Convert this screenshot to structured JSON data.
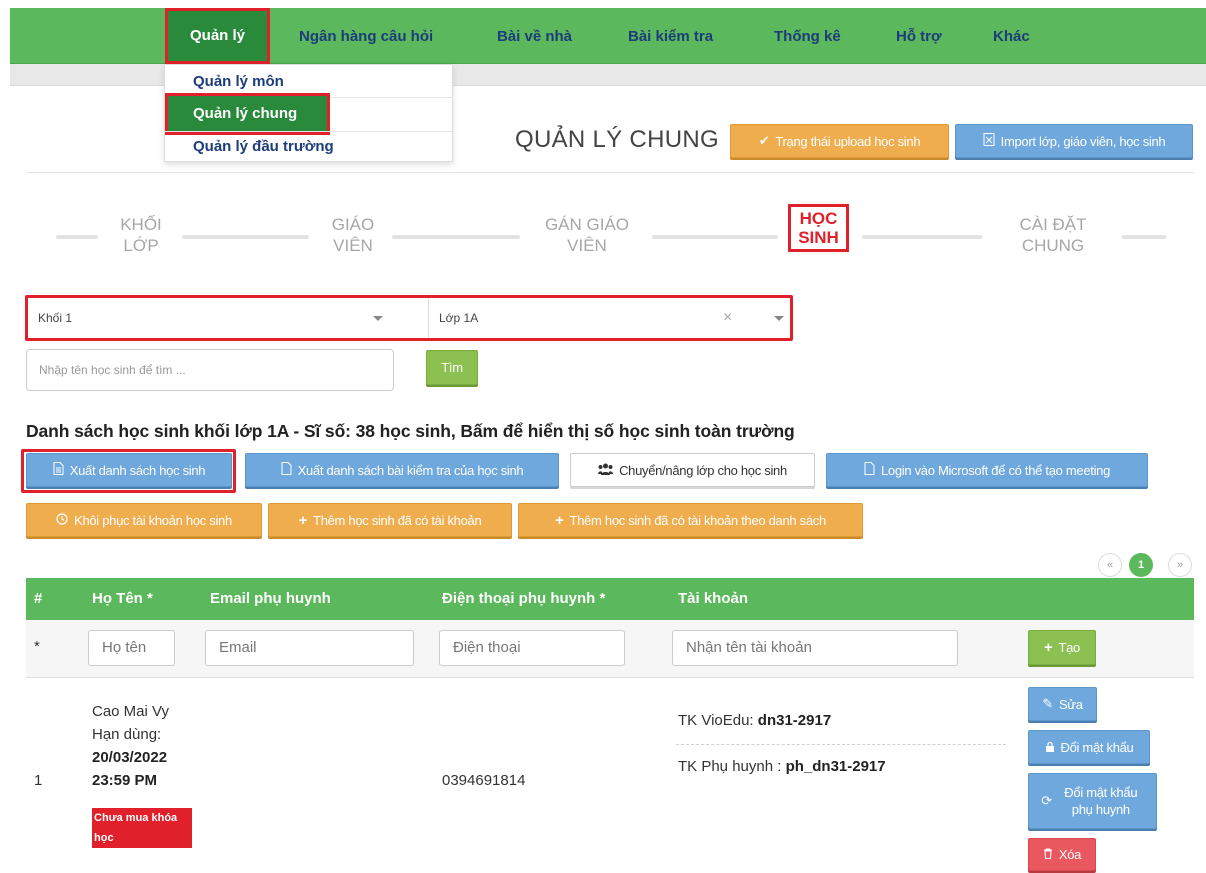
{
  "nav": {
    "items": [
      {
        "label": "Quản lý",
        "active": true
      },
      {
        "label": "Ngân hàng câu hỏi"
      },
      {
        "label": "Bài về nhà"
      },
      {
        "label": "Bài kiểm tra"
      },
      {
        "label": "Thống kê"
      },
      {
        "label": "Hỗ trợ"
      },
      {
        "label": "Khác"
      }
    ],
    "dropdown": [
      {
        "label": "Quản lý môn"
      },
      {
        "label": "Quản lý chung",
        "active": true
      },
      {
        "label": "Quản lý đầu trường"
      }
    ]
  },
  "header": {
    "title": "QUẢN LÝ CHUNG",
    "upload_status_label": "Trạng thái upload học sinh",
    "import_label": "Import lớp, giáo viên, học sinh"
  },
  "steps": [
    {
      "line1": "KHỐI",
      "line2": "LỚP"
    },
    {
      "line1": "GIÁO",
      "line2": "VIÊN"
    },
    {
      "line1": "GÁN GIÁO",
      "line2": "VIÊN"
    },
    {
      "line1": "HỌC",
      "line2": "SINH",
      "active": true
    },
    {
      "line1": "CÀI ĐẶT",
      "line2": "CHUNG"
    }
  ],
  "filters": {
    "grade_value": "Khối 1",
    "class_value": "Lớp 1A",
    "clear_symbol": "×",
    "search_placeholder": "Nhập tên học sinh để tìm ...",
    "search_button": "Tìm"
  },
  "list_title": "Danh sách học sinh khối lớp 1A - Sĩ số: 38 học sinh, Bấm để hiển thị số học sinh toàn trường",
  "actions": {
    "export_students": "Xuất danh sách học sinh",
    "export_tests": "Xuất danh sách bài kiểm tra của học sinh",
    "move_class": "Chuyển/nâng lớp cho học sinh",
    "login_microsoft": "Login vào Microsoft để có thể tạo meeting",
    "restore_accounts": "Khôi phục tài khoản học sinh",
    "add_existing": "Thêm học sinh đã có tài khoản",
    "add_existing_list": "Thêm học sinh đã có tài khoản theo danh sách"
  },
  "pagination": {
    "prev": "«",
    "current": "1",
    "next": "»"
  },
  "table": {
    "headers": [
      "#",
      "Họ Tên *",
      "Email phụ huynh",
      "Điện thoại phụ huynh *",
      "Tài khoản"
    ],
    "new_row": {
      "marker": "*",
      "name_placeholder": "Họ tên",
      "email_placeholder": "Email",
      "phone_placeholder": "Điện thoại",
      "account_placeholder": "Nhận tên tài khoản",
      "create_label": "Tạo"
    },
    "rows": [
      {
        "index": "1",
        "name": "Cao Mai Vy",
        "expiry_label": "Hạn dùng:",
        "expiry_date": "20/03/2022",
        "expiry_time": "23:59 PM",
        "badge": "Chưa mua khóa học",
        "phone": "0394691814",
        "vioedu_label": "TK VioEdu: ",
        "vioedu_account": "dn31-2917",
        "parent_label": "TK Phụ huynh : ",
        "parent_account": "ph_dn31-2917",
        "edit_label": "Sửa",
        "change_password_label": "Đổi mật khẩu",
        "change_parent_password_label": "Đổi mật khẩu phụ huynh",
        "delete_label": "Xóa"
      }
    ]
  },
  "colors": {
    "nav_green": "#5cb85c",
    "active_green": "#2a8a3c",
    "highlight_red": "#e0202a",
    "orange": "#f0ad4e",
    "blue": "#6fa8dc",
    "link_navy": "#1d3c7a"
  },
  "icons": [
    "check-icon",
    "spreadsheet-icon",
    "document-icon",
    "users-icon",
    "history-icon",
    "plus-icon",
    "pencil-icon",
    "lock-icon",
    "refresh-icon",
    "trash-icon",
    "caret-down-icon"
  ]
}
